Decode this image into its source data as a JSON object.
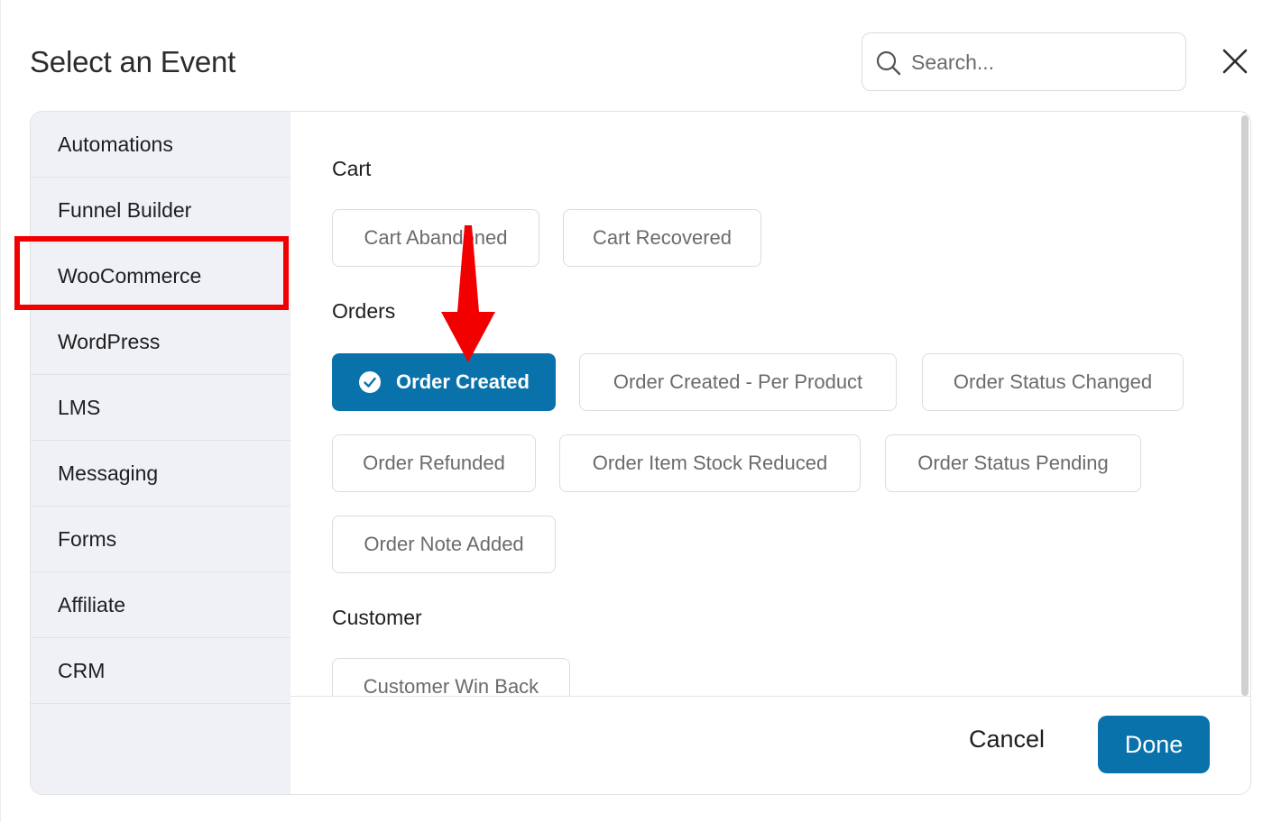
{
  "dialog": {
    "title": "Select an Event",
    "search_placeholder": "Search..."
  },
  "sidebar": {
    "items": [
      {
        "label": "Automations"
      },
      {
        "label": "Funnel Builder"
      },
      {
        "label": "WooCommerce",
        "highlighted": true
      },
      {
        "label": "WordPress"
      },
      {
        "label": "LMS"
      },
      {
        "label": "Messaging"
      },
      {
        "label": "Forms"
      },
      {
        "label": "Affiliate"
      },
      {
        "label": "CRM"
      }
    ]
  },
  "sections": {
    "cart": {
      "title": "Cart",
      "events": [
        "Cart Abandoned",
        "Cart Recovered"
      ]
    },
    "orders": {
      "title": "Orders",
      "events": [
        "Order Created",
        "Order Created - Per Product",
        "Order Status Changed",
        "Order Refunded",
        "Order Item Stock Reduced",
        "Order Status Pending",
        "Order Note Added"
      ],
      "selected": "Order Created"
    },
    "customer": {
      "title": "Customer",
      "events": [
        "Customer Win Back"
      ]
    }
  },
  "footer": {
    "cancel_label": "Cancel",
    "done_label": "Done"
  },
  "colors": {
    "primary": "#0a72aa",
    "annotation": "#f20000",
    "sidebar_bg": "#f0f1f6"
  },
  "icons": {
    "search": "search-icon",
    "close": "close-icon",
    "check": "check-circle-icon"
  }
}
